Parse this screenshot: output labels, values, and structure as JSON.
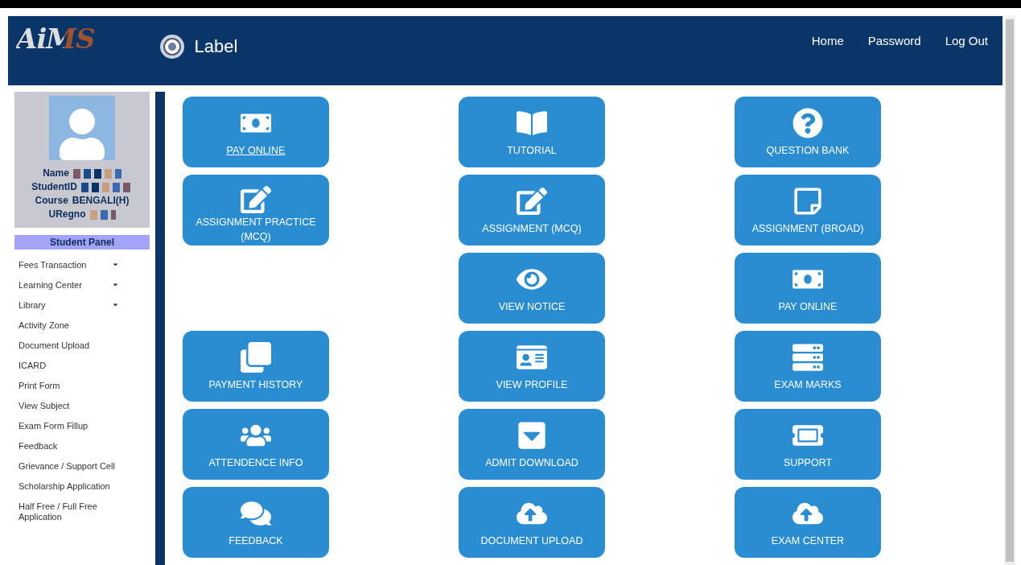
{
  "header": {
    "logo": "AiMS",
    "title": "Label",
    "nav": [
      {
        "label": "Home"
      },
      {
        "label": "Password"
      },
      {
        "label": "Log Out"
      }
    ]
  },
  "profile": {
    "fields": [
      {
        "label": "Name",
        "kind": "redacted"
      },
      {
        "label": "StudentID",
        "kind": "redacted"
      },
      {
        "label": "Course",
        "kind": "text",
        "value": "BENGALI(H)"
      },
      {
        "label": "URegno",
        "kind": "redacted"
      }
    ],
    "panel_title": "Student Panel"
  },
  "sidebar": {
    "items": [
      {
        "label": "Fees Transaction",
        "has_submenu": true
      },
      {
        "label": "Learning Center",
        "has_submenu": true
      },
      {
        "label": "Library",
        "has_submenu": true
      },
      {
        "label": "Activity Zone",
        "has_submenu": false
      },
      {
        "label": "Document Upload",
        "has_submenu": false
      },
      {
        "label": "ICARD",
        "has_submenu": false
      },
      {
        "label": "Print Form",
        "has_submenu": false
      },
      {
        "label": "View Subject",
        "has_submenu": false
      },
      {
        "label": "Exam Form Fillup",
        "has_submenu": false
      },
      {
        "label": "Feedback",
        "has_submenu": false
      },
      {
        "label": "Grievance / Support Cell",
        "has_submenu": false
      },
      {
        "label": "Scholarship Application",
        "has_submenu": false
      },
      {
        "label": "Half Free / Full Free Application",
        "has_submenu": false
      }
    ]
  },
  "tiles": [
    {
      "kind": "tile",
      "label": "PAY ONLINE",
      "underlined": true
    },
    {
      "kind": "tile",
      "label": "TUTORIAL",
      "underlined": false
    },
    {
      "kind": "tile",
      "label": "QUESTION BANK",
      "underlined": false
    },
    {
      "kind": "tile",
      "label": "ASSIGNMENT PRACTICE (MCQ)",
      "underlined": false
    },
    {
      "kind": "tile",
      "label": "ASSIGNMENT (MCQ)",
      "underlined": false
    },
    {
      "kind": "tile",
      "label": "ASSIGNMENT (BROAD)",
      "underlined": false
    },
    {
      "kind": "empty"
    },
    {
      "kind": "tile",
      "label": "VIEW NOTICE",
      "underlined": false
    },
    {
      "kind": "tile",
      "label": "PAY ONLINE",
      "underlined": false
    },
    {
      "kind": "tile",
      "label": "PAYMENT HISTORY",
      "underlined": false
    },
    {
      "kind": "tile",
      "label": "VIEW PROFILE",
      "underlined": false
    },
    {
      "kind": "tile",
      "label": "EXAM MARKS",
      "underlined": false
    },
    {
      "kind": "tile",
      "label": "ATTENDENCE INFO",
      "underlined": false
    },
    {
      "kind": "tile",
      "label": "ADMIT DOWNLOAD",
      "underlined": false
    },
    {
      "kind": "tile",
      "label": "SUPPORT",
      "underlined": false
    },
    {
      "kind": "tile",
      "label": "FEEDBACK",
      "underlined": false
    },
    {
      "kind": "tile",
      "label": "DOCUMENT UPLOAD",
      "underlined": false
    },
    {
      "kind": "tile",
      "label": "EXAM CENTER",
      "underlined": false
    }
  ]
}
